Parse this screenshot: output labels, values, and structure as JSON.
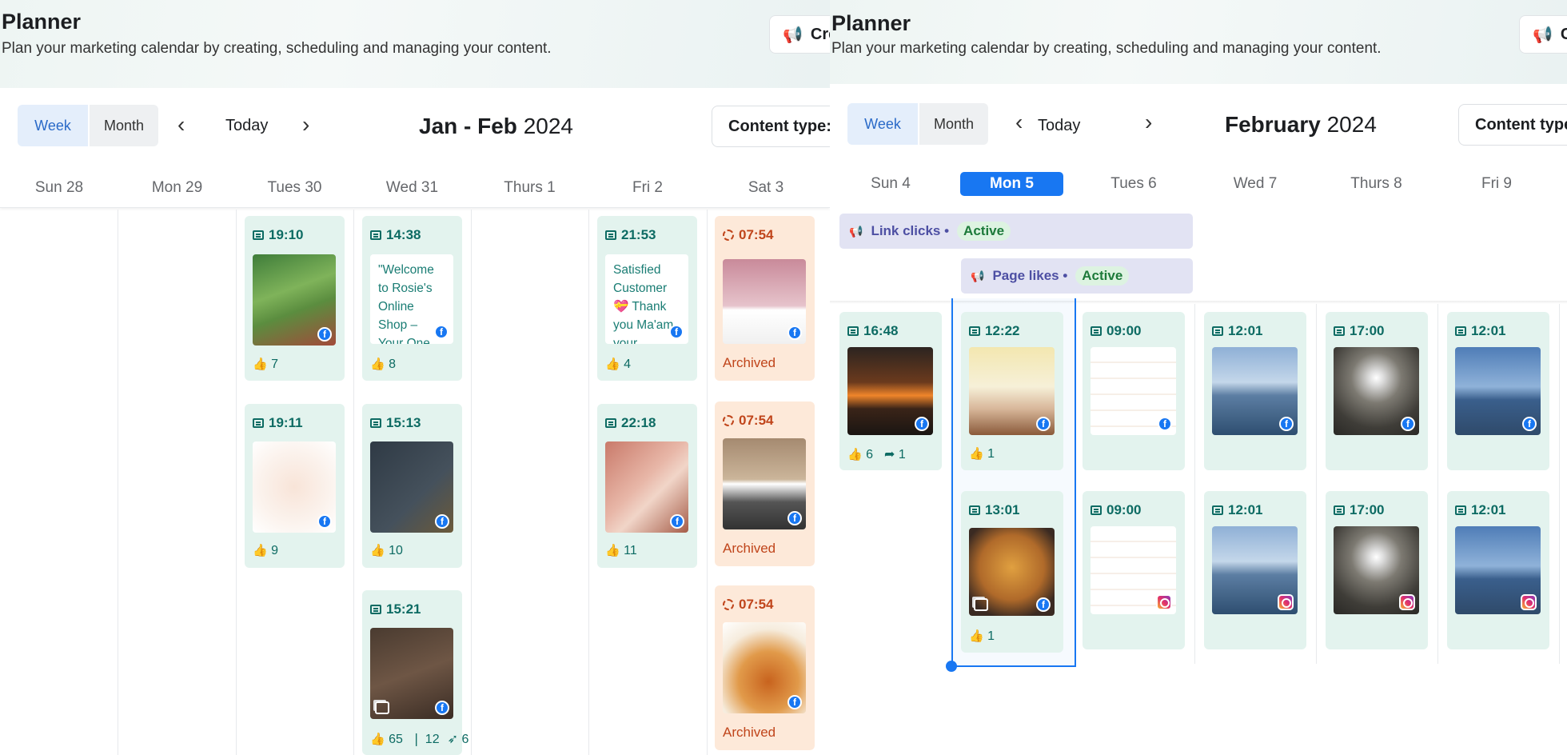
{
  "left": {
    "title": "Planner",
    "subtitle": "Plan your marketing calendar by creating, scheduling and managing your content.",
    "create_label": "Cre",
    "view_week": "Week",
    "view_month": "Month",
    "today": "Today",
    "range_bold": "Jan - Feb",
    "range_year": "2024",
    "content_type": "Content type: .",
    "days": [
      "Sun 28",
      "Mon 29",
      "Tues 30",
      "Wed 31",
      "Thurs 1",
      "Fri 2",
      "Sat 3"
    ],
    "posts": {
      "tue1": {
        "time": "19:10",
        "likes": "7"
      },
      "tue2": {
        "time": "19:11",
        "likes": "9"
      },
      "wed1": {
        "time": "14:38",
        "text": "\"Welcome to Rosie's Online Shop – Your One",
        "likes": "8"
      },
      "wed2": {
        "time": "15:13",
        "likes": "10"
      },
      "wed3": {
        "time": "15:21",
        "likes": "65",
        "comments": "12",
        "shares": "6"
      },
      "fri1": {
        "time": "21:53",
        "text": "Satisfied Customer 💝 Thank you Ma'am your",
        "likes": "4"
      },
      "fri2": {
        "time": "22:18",
        "likes": "11"
      },
      "sat1": {
        "time": "07:54",
        "status": "Archived"
      },
      "sat2": {
        "time": "07:54",
        "status": "Archived"
      },
      "sat3": {
        "time": "07:54",
        "status": "Archived"
      }
    }
  },
  "right": {
    "title": "Planner",
    "subtitle": "Plan your marketing calendar by creating, scheduling and managing your content.",
    "create_label": "C",
    "view_week": "Week",
    "view_month": "Month",
    "today": "Today",
    "range_bold": "February",
    "range_year": "2024",
    "content_type": "Content type",
    "days": [
      "Sun 4",
      "Mon 5",
      "Tues 6",
      "Wed 7",
      "Thurs 8",
      "Fri 9"
    ],
    "boosts": [
      {
        "label": "Link clicks •",
        "status": "Active"
      },
      {
        "label": "Page likes •",
        "status": "Active"
      }
    ],
    "posts": {
      "sun1": {
        "time": "16:48",
        "likes": "6",
        "shares": "1"
      },
      "mon1": {
        "time": "12:22",
        "likes": "1"
      },
      "mon2": {
        "time": "13:01",
        "likes": "1"
      },
      "tue1": {
        "time": "09:00"
      },
      "tue2": {
        "time": "09:00"
      },
      "wed1": {
        "time": "12:01"
      },
      "wed2": {
        "time": "12:01"
      },
      "thu1": {
        "time": "17:00"
      },
      "thu2": {
        "time": "17:00"
      },
      "fri1": {
        "time": "12:01"
      },
      "fri2": {
        "time": "12:01"
      }
    }
  },
  "colors": {
    "accent": "#1877f2",
    "card": "#e3f3ee",
    "archived": "#fde9d9",
    "boost": "#e2e3f3"
  }
}
